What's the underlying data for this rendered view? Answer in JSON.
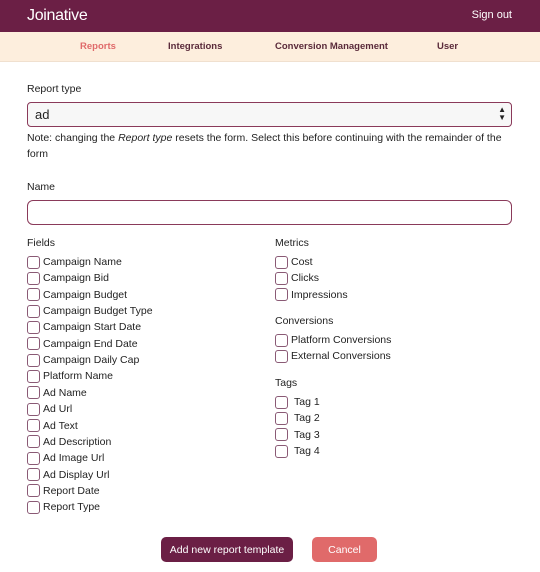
{
  "header": {
    "logo": "Joinative",
    "sign_out": "Sign out"
  },
  "nav": [
    {
      "label": "Reports",
      "active": true
    },
    {
      "label": "Integrations"
    },
    {
      "label": "Conversion Management"
    },
    {
      "label": "User"
    }
  ],
  "report_type": {
    "label": "Report type",
    "value": "ad",
    "note_pre": "Note: changing the ",
    "note_em": "Report type",
    "note_post": " resets the form. Select this before continuing with the remainder of the form"
  },
  "name": {
    "label": "Name",
    "value": ""
  },
  "fields": {
    "label": "Fields",
    "items": [
      "Campaign Name",
      "Campaign Bid",
      "Campaign Budget",
      "Campaign Budget Type",
      "Campaign Start Date",
      "Campaign End Date",
      "Campaign Daily Cap",
      "Platform Name",
      "Ad Name",
      "Ad Url",
      "Ad Text",
      "Ad Description",
      "Ad Image Url",
      "Ad Display Url",
      "Report Date",
      "Report Type"
    ]
  },
  "metrics": {
    "label": "Metrics",
    "items": [
      "Cost",
      "Clicks",
      "Impressions"
    ]
  },
  "conversions": {
    "label": "Conversions",
    "items": [
      "Platform Conversions",
      "External Conversions"
    ]
  },
  "tags": {
    "label": "Tags",
    "items": [
      "Tag 1",
      "Tag 2",
      "Tag 3",
      "Tag 4"
    ]
  },
  "buttons": {
    "add": "Add new report template",
    "cancel": "Cancel"
  },
  "colors": {
    "brand": "#6b1f45",
    "nav_bg": "#fdeedd",
    "active": "#e06a6a",
    "cancel": "#e06a6a"
  }
}
